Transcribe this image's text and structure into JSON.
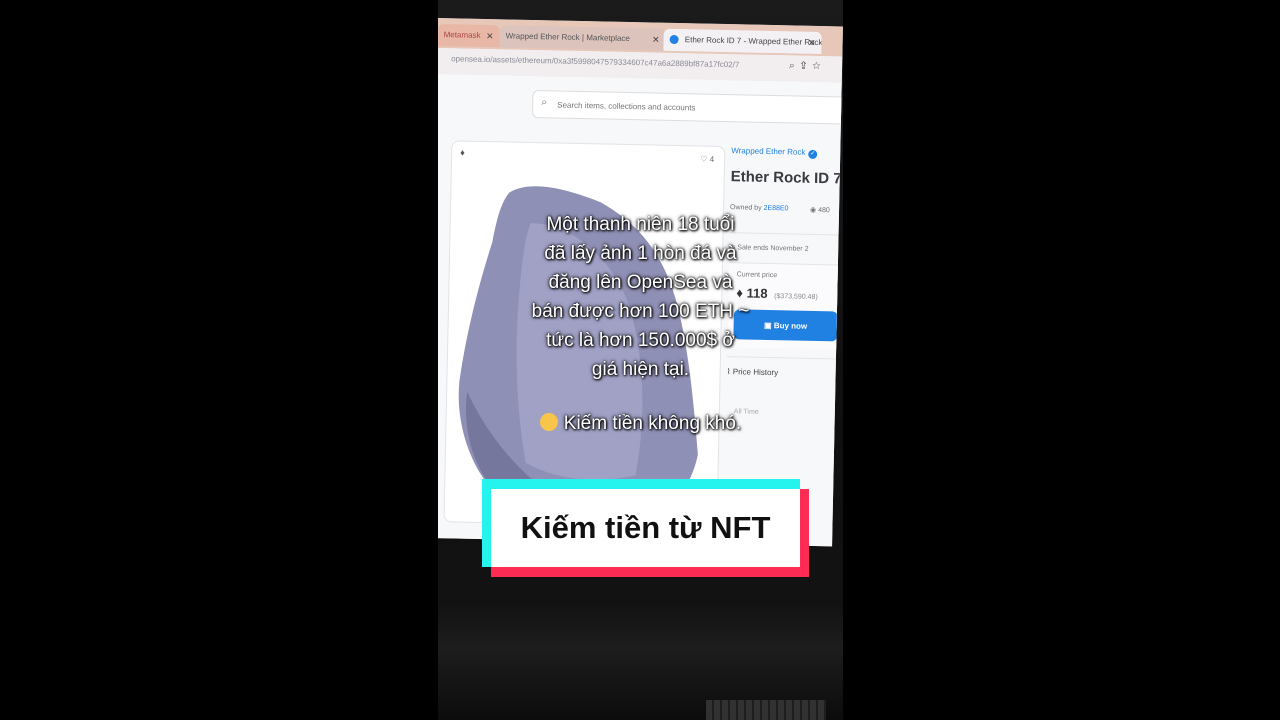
{
  "browser": {
    "tabs": [
      {
        "title": "Metamask"
      },
      {
        "title": "Wrapped Ether Rock | Marketplace"
      },
      {
        "title": "Ether Rock ID 7 - Wrapped Ether Rock"
      }
    ],
    "url": "opensea.io/assets/ethereum/0xa3f5998047579334607c47a6a2889bf87a17fc02/7",
    "search_placeholder": "Search items, collections and accounts"
  },
  "asset": {
    "favorites": "4",
    "collection": "Wrapped Ether Rock",
    "verified_mark": "✓",
    "title": "Ether Rock ID 7",
    "owned_prefix": "Owned by",
    "owner": "2E88E0",
    "views": "480",
    "sale_ends": "Sale ends November 2",
    "current_price_label": "Current price",
    "price": "118",
    "price_usd": "($373,590.48)",
    "buy_label": "Buy now",
    "price_history_label": "Price History",
    "all_time_label": "All Time"
  },
  "overlay": {
    "caption_lines": [
      "Một thanh niên 18 tuổi",
      "đã lấy ảnh 1 hòn đá và",
      "đăng lên OpenSea và",
      "bán được hơn 100 ETH ~",
      "tức là hơn 150.000$ ở",
      "giá hiện tại."
    ],
    "caption_footer": "Kiếm tiền không khó.",
    "banner": "Kiếm tiền từ NFT"
  },
  "colors": {
    "opensea_blue": "#2081e2",
    "tiktok_cyan": "#25f4ee",
    "tiktok_red": "#fe2c55",
    "rock": "#8f90b5"
  },
  "icons": [
    "ethereum-icon",
    "heart-icon",
    "eye-icon",
    "clock-icon",
    "wallet-icon",
    "chart-line-icon",
    "search-icon",
    "star-icon",
    "smile-emoji-icon"
  ]
}
